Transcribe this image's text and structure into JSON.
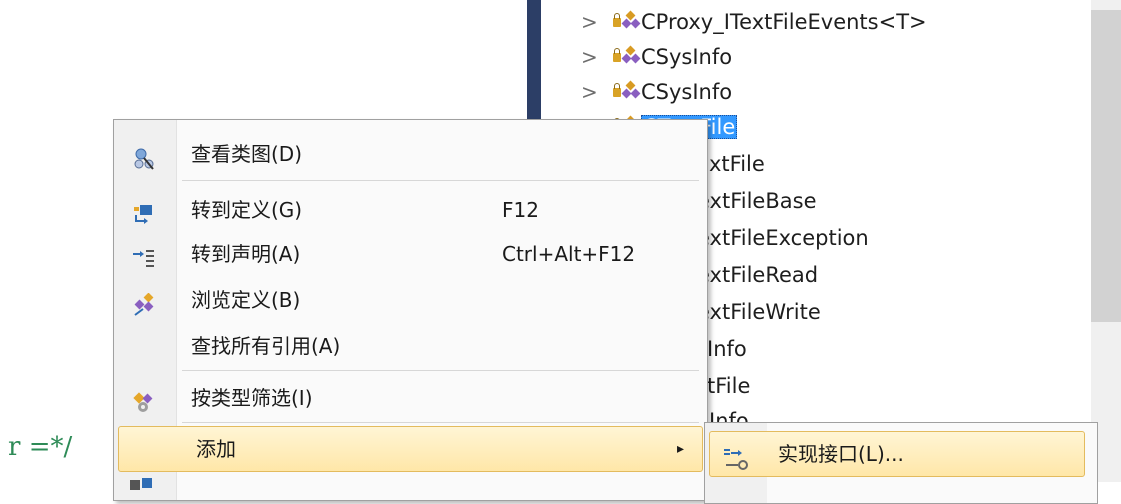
{
  "editor": {
    "code_fragment": "r =*/"
  },
  "class_view": {
    "items": [
      {
        "label": "CProxy_ITextFileEvents<T>",
        "expander": ">",
        "selected": false
      },
      {
        "label": "CSysInfo",
        "expander": ">",
        "selected": false
      },
      {
        "label": "CSysInfo",
        "expander": ">",
        "selected": false
      },
      {
        "label": "CTextFile",
        "expander": ">",
        "selected": true
      },
      {
        "label": "xtFile",
        "expander": "",
        "selected": false
      },
      {
        "label": "extFileBase",
        "expander": "",
        "selected": false
      },
      {
        "label": "extFileException",
        "expander": "",
        "selected": false
      },
      {
        "label": "extFileRead",
        "expander": "",
        "selected": false
      },
      {
        "label": "extFileWrite",
        "expander": "",
        "selected": false
      },
      {
        "label": "Info",
        "expander": "",
        "selected": false
      },
      {
        "label": "tFile",
        "expander": "",
        "selected": false
      },
      {
        "label": "Info",
        "expander": "",
        "selected": false
      }
    ],
    "selection_color": "#3399ff",
    "stripe_color": "#2c3e66"
  },
  "context_menu": {
    "items": [
      {
        "label": "查看类图(D)",
        "shortcut": "",
        "icon": "class-diagram-icon"
      },
      {
        "label": "转到定义(G)",
        "shortcut": "F12",
        "icon": "go-to-definition-icon"
      },
      {
        "label": "转到声明(A)",
        "shortcut": "Ctrl+Alt+F12",
        "icon": "go-to-declaration-icon"
      },
      {
        "label": "浏览定义(B)",
        "shortcut": "",
        "icon": "browse-definition-icon"
      },
      {
        "label": "查找所有引用(A)",
        "shortcut": "",
        "icon": ""
      },
      {
        "label": "按类型筛选(I)",
        "shortcut": "",
        "icon": "filter-by-type-icon"
      },
      {
        "label": "添加",
        "shortcut": "",
        "icon": "",
        "submenu_arrow": "▸",
        "highlighted": true
      }
    ],
    "highlight_color": "#ffe7a8"
  },
  "submenu": {
    "items": [
      {
        "label": "实现接口(L)...",
        "icon": "implement-interface-icon",
        "highlighted": true
      }
    ]
  }
}
